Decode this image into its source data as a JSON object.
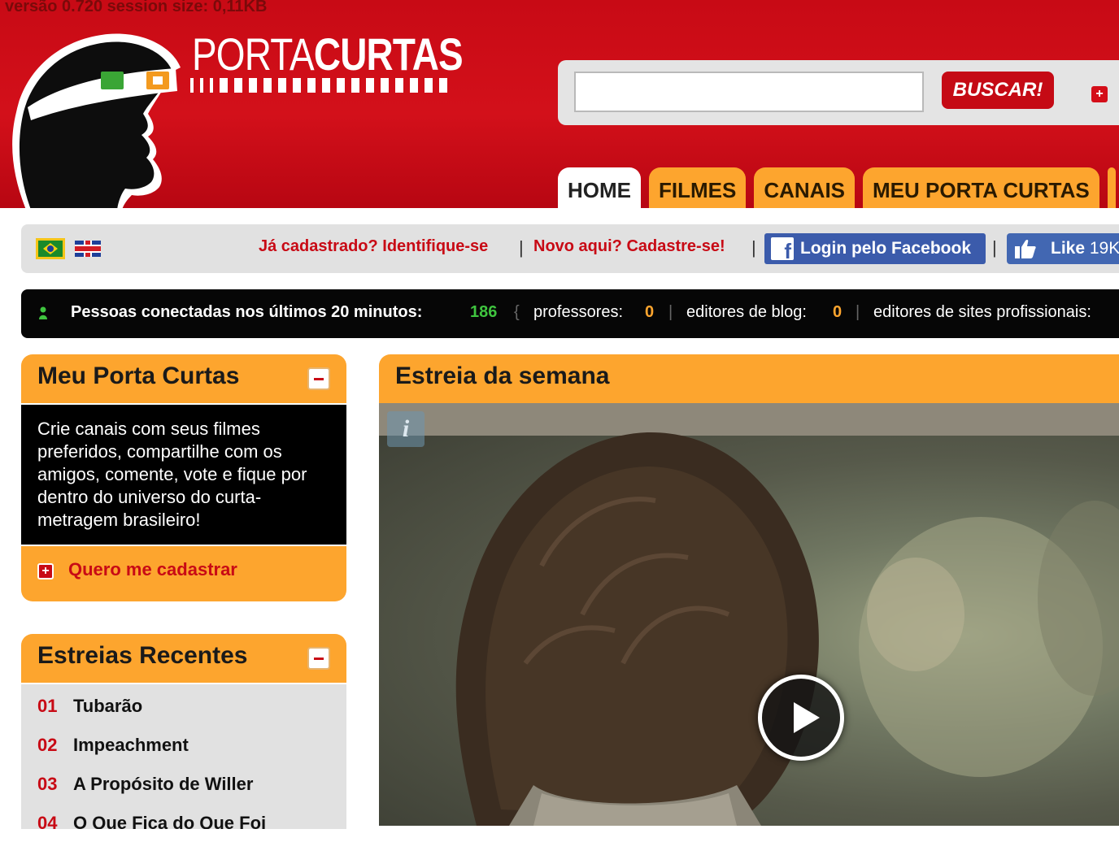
{
  "header": {
    "version_text": "versão 0.720 session size: 0,11KB",
    "logo": {
      "word_thin": "PORTA",
      "word_bold": "CURTAS"
    },
    "search": {
      "value": "",
      "placeholder": "",
      "button_label": "BUSCAR!",
      "advanced_label": "+"
    }
  },
  "nav": {
    "tabs": [
      {
        "label": "HOME",
        "active": true
      },
      {
        "label": "FILMES",
        "active": false
      },
      {
        "label": "CANAIS",
        "active": false
      },
      {
        "label": "MEU PORTA CURTAS",
        "active": false
      }
    ]
  },
  "login_bar": {
    "languages": [
      "flag-brazil-icon",
      "flag-uk-icon"
    ],
    "already_registered": "Já cadastrado? Identifique-se",
    "new_here": "Novo aqui? Cadastre-se!",
    "separator": "|",
    "facebook_login": "Login pelo Facebook",
    "facebook_icon_letter": "f",
    "like_label": "Like",
    "like_count": "19K"
  },
  "online": {
    "label": "Pessoas conectadas nos últimos 20 minutos:",
    "count": "186",
    "brace": "{",
    "divider": "|",
    "teachers_label": "professores:",
    "teachers_count": "0",
    "blog_editors_label": "editores de blog:",
    "blog_editors_count": "0",
    "pro_sites_label": "editores de sites profissionais:"
  },
  "meu_porta_curtas": {
    "title": "Meu Porta Curtas",
    "description": "Crie canais com seus filmes preferidos, compartilhe com os amigos, comente, vote e fique por dentro do universo do curta-metragem brasileiro!",
    "cta": "Quero me cadastrar",
    "cta_icon_text": "+"
  },
  "estreias_recentes": {
    "title": "Estreias Recentes",
    "items": [
      {
        "num": "01",
        "title": "Tubarão"
      },
      {
        "num": "02",
        "title": "Impeachment"
      },
      {
        "num": "03",
        "title": "A Propósito de Willer"
      },
      {
        "num": "04",
        "title": "O Que Fica do Que Foi"
      }
    ]
  },
  "feature": {
    "title": "Estreia da semana",
    "info_icon_text": "i"
  },
  "colors": {
    "brand_red": "#c80a15",
    "accent_orange": "#fda52e",
    "facebook_blue": "#3b5bab",
    "online_green": "#3fc43f"
  }
}
